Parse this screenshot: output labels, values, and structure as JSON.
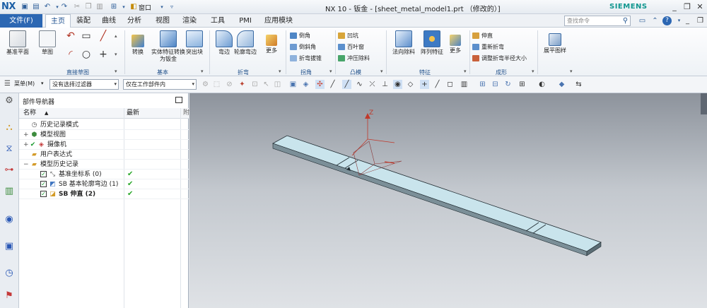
{
  "title_bar": {
    "logo": "NX",
    "quick_access": [
      "save-icon",
      "save-all-icon",
      "undo-icon",
      "redo-icon",
      "cut-icon",
      "copy-icon",
      "paste-icon",
      "touch-mode-icon",
      "window-icon"
    ],
    "window_menu": "窗口",
    "title": "NX 10 - 钣金 - [sheet_metal_model1.prt （修改的）]",
    "brand": "SIEMENS",
    "window_controls": [
      "minimize-icon",
      "restore-icon",
      "close-icon"
    ]
  },
  "menu": {
    "file": "文件(F)",
    "tabs": [
      "主页",
      "装配",
      "曲线",
      "分析",
      "视图",
      "渲染",
      "工具",
      "PMI",
      "应用模块"
    ],
    "active_tab": "主页",
    "search_placeholder": "查找命令"
  },
  "ribbon": {
    "datum_plane": "基准平面",
    "sketch": "草图",
    "convert": "转换",
    "solid_to_sheet": "实体特征转换为钣金",
    "tab_btn": "突出块",
    "flange": "弯边",
    "contour_flange": "轮廓弯边",
    "more": "更多",
    "corner_items": [
      "倒角",
      "倒斜角",
      "折弯拔锥"
    ],
    "punch_items": [
      "凹坑",
      "百叶窗",
      "冲压除料"
    ],
    "normal_cutout": "法向除料",
    "pattern_feature": "阵列特征",
    "forming_items": [
      "伸直",
      "重新折弯",
      "调整折弯半径大小"
    ],
    "flat_pattern": "展平图样",
    "groups": {
      "direct_sketch": "直接草图",
      "basic": "基本",
      "bend": "折弯",
      "corner": "拐角",
      "punch": "凸模",
      "feature": "特征",
      "forming": "成形"
    }
  },
  "toolbar": {
    "menu_label": "菜单(M)",
    "filter_value": "没有选择过滤器",
    "scope_value": "仅在工作部件内"
  },
  "navigator": {
    "title": "部件导航器",
    "columns": {
      "name": "名称",
      "latest": "最新",
      "extra": "附"
    },
    "rows": [
      {
        "label": "历史记录模式",
        "level": 0
      },
      {
        "label": "模型视图",
        "level": 0
      },
      {
        "label": "摄像机",
        "level": 0
      },
      {
        "label": "用户表达式",
        "level": 0
      },
      {
        "label": "模型历史记录",
        "level": 0
      },
      {
        "label": "基准坐标系 (0)",
        "level": 1,
        "latest": "✔"
      },
      {
        "label": "SB 基本轮廓弯边 (1)",
        "level": 1,
        "latest": "✔"
      },
      {
        "label": "SB 伸直 (2)",
        "level": 1,
        "latest": "✔",
        "bold": true
      }
    ]
  },
  "viewport": {
    "axis_label": "Z",
    "part_color": "#c9e4ec",
    "edge_color": "#1f2a30"
  }
}
